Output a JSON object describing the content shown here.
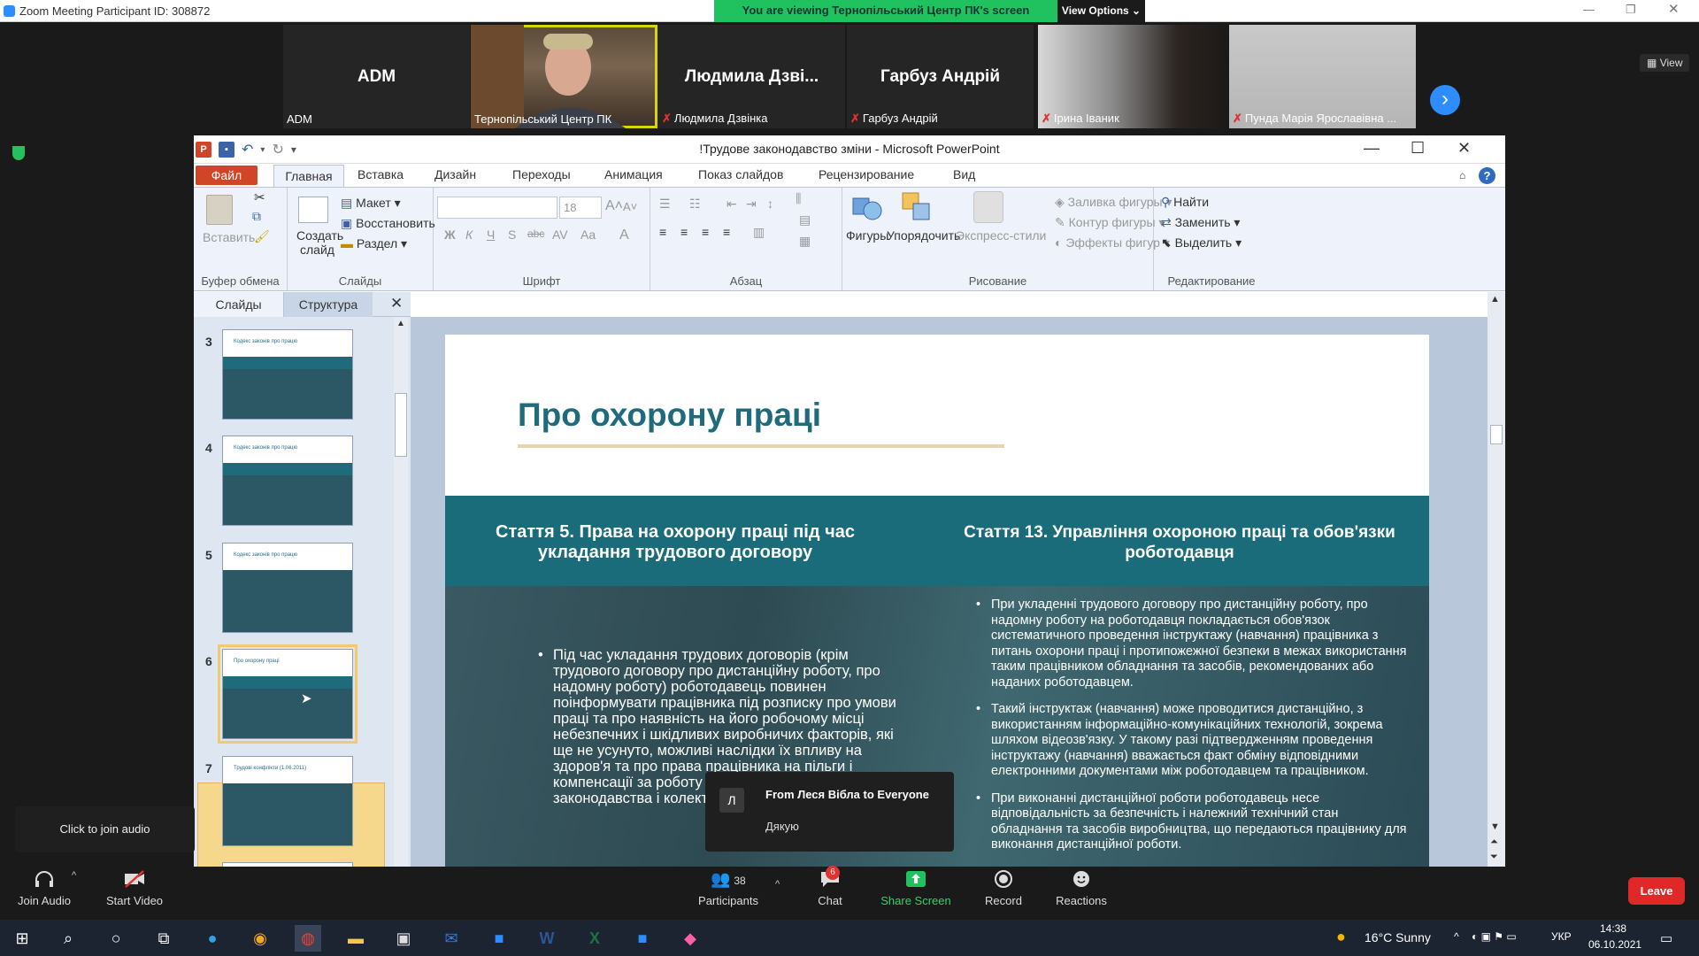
{
  "zoom": {
    "window_title": "Zoom Meeting Participant ID: 308872",
    "banner_text": "You are viewing Тернопільський Центр ПК's screen",
    "view_options": "View Options",
    "view_label": "View",
    "participants": [
      {
        "big_name": "ADM",
        "label": "ADM",
        "muted": false
      },
      {
        "big_name": "",
        "label": "Тернопільський Центр ПК",
        "muted": false
      },
      {
        "big_name": "Людмила  Дзві...",
        "label": "Людмила Дзвінка",
        "muted": true
      },
      {
        "big_name": "Гарбуз Андрій",
        "label": "Гарбуз Андрій",
        "muted": true
      },
      {
        "big_name": "",
        "label": "Ірина Іваник",
        "muted": true
      },
      {
        "big_name": "",
        "label": "Пунда Марія Ярославівна ...",
        "muted": true
      }
    ],
    "tooltip": "Click to join audio",
    "chat": {
      "avatar": "Л",
      "from": "From Леся Вібла to Everyone",
      "message": "Дякую"
    },
    "toolbar": {
      "join_audio": "Join Audio",
      "start_video": "Start Video",
      "participants_count": "38",
      "participants": "Participants",
      "chat": "Chat",
      "chat_badge": "6",
      "share_screen": "Share Screen",
      "record": "Record",
      "reactions": "Reactions",
      "leave": "Leave"
    }
  },
  "ppt": {
    "doc_title": "!Трудове законодавство зміни  -  Microsoft PowerPoint",
    "tabs": [
      "Файл",
      "Главная",
      "Вставка",
      "Дизайн",
      "Переходы",
      "Анимация",
      "Показ слайдов",
      "Рецензирование",
      "Вид"
    ],
    "ribbon": {
      "paste": "Вставить",
      "clipboard_group": "Буфер обмена",
      "new_slide_1": "Создать",
      "new_slide_2": "слайд",
      "layout": "Макет",
      "reset": "Восстановить",
      "section": "Раздел",
      "slides_group": "Слайды",
      "font_size": "18",
      "font_group": "Шрифт",
      "paragraph_group": "Абзац",
      "shapes": "Фигуры",
      "arrange": "Упорядочить",
      "quick_styles": "Экспресс-стили",
      "shape_fill": "Заливка фигуры",
      "shape_outline": "Контур фигуры",
      "shape_effects": "Эффекты фигур",
      "drawing_group": "Рисование",
      "find": "Найти",
      "replace": "Заменить",
      "select": "Выделить",
      "editing_group": "Редактирование"
    },
    "pane_tabs": {
      "slides": "Слайды",
      "outline": "Структура"
    },
    "thumbnails": [
      {
        "num": "3",
        "title": "Кодекс законів про працю"
      },
      {
        "num": "4",
        "title": "Кодекс законів про працю"
      },
      {
        "num": "5",
        "title": "Кодекс законів про працю"
      },
      {
        "num": "6",
        "title": "Про охорону праці"
      },
      {
        "num": "7",
        "title": "Трудові конфлікти (1.06.2011)"
      }
    ],
    "slide": {
      "title": "Про охорону праці",
      "heading_left": "Стаття 5. Права на охорону праці під час укладання трудового договору",
      "heading_right": "Стаття 13. Управління охороною праці та обов'язки роботодавця",
      "left_bullet": "Під час укладання трудових договорів (крім трудового договору про дистанційну роботу, про надомну роботу) роботодавець повинен поінформувати працівника під розписку про умови праці та про наявність на його робочому місці небезпечних і шкідливих виробничих факторів, які ще не усунуто, можливі наслідки їх впливу на здоров'я та про права працівника на пільги і компенсації за роботу в таких умовах відповідно до законодавства і колективного договору.",
      "right_bullets": [
        "При укладенні трудового договору про дистанційну роботу, про надомну роботу на роботодавця покладається обов'язок систематичного проведення інструктажу (навчання) працівника з питань охорони праці і протипожежної безпеки в межах використання таким працівником обладнання та засобів, рекомендованих або наданих роботодавцем.",
        "Такий інструктаж (навчання) може проводитися дистанційно, з використанням інформаційно-комунікаційних технологій, зокрема шляхом відеозв'язку. У такому разі підтвердженням проведення інструктажу (навчання) вважається факт обміну відповідними електронними документами між роботодавцем та працівником.",
        "При виконанні дистанційної роботи роботодавець несе відповідальність за безпечність і належний технічний стан обладнання та засобів виробництва, що передаються працівнику для виконання дистанційної роботи."
      ],
      "page_marker": "6"
    }
  },
  "taskbar": {
    "weather": "16°C  Sunny",
    "lang": "УКР",
    "time": "14:38",
    "date": "06.10.2021"
  },
  "colors": {
    "zoom_green": "#20c25f",
    "ppt_file_tab": "#d04525",
    "slide_teal": "#1b6c7a",
    "leave_red": "#e02828"
  }
}
